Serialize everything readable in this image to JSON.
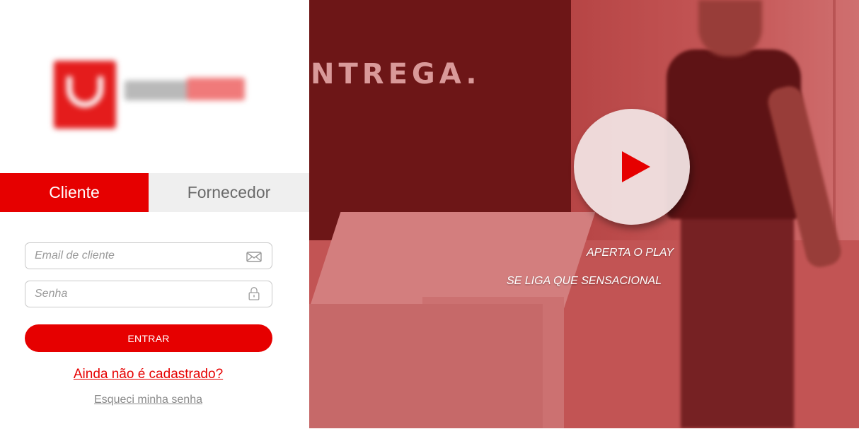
{
  "login": {
    "tabs": [
      {
        "label": "Cliente",
        "active": true
      },
      {
        "label": "Fornecedor",
        "active": false
      }
    ],
    "email": {
      "placeholder": "Email de cliente",
      "value": ""
    },
    "password": {
      "placeholder": "Senha",
      "value": ""
    },
    "submit_label": "ENTRAR",
    "signup_link": "Ainda não é cadastrado?",
    "forgot_link": "Esqueci minha senha"
  },
  "video": {
    "background_wall_text": "NTREGA.",
    "caption_line1": "APERTA O PLAY",
    "caption_line2": "SE LIGA QUE SENSACIONAL",
    "play_icon": "play-icon"
  },
  "colors": {
    "accent": "#e60000",
    "tab_inactive_bg": "#efefef",
    "tab_inactive_text": "#6a6a6a",
    "link_muted": "#8a8a8a"
  }
}
